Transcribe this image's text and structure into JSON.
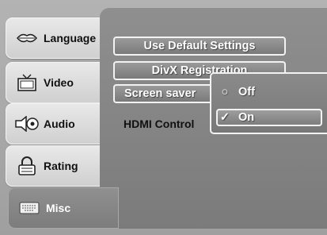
{
  "sidebar": {
    "items": [
      {
        "label": "Language",
        "icon": "lips-icon"
      },
      {
        "label": "Video",
        "icon": "tv-icon"
      },
      {
        "label": "Audio",
        "icon": "speaker-icon"
      },
      {
        "label": "Rating",
        "icon": "lock-icon"
      },
      {
        "label": "Misc",
        "icon": "keyboard-icon"
      }
    ],
    "active": "Misc"
  },
  "menu": {
    "use_default_settings": "Use Default Settings",
    "divx_registration": "DivX Registration",
    "screen_saver": "Screen saver",
    "hdmi_control": "HDMI Control"
  },
  "popup": {
    "options": [
      {
        "label": "Off",
        "mark": "○"
      },
      {
        "label": "On",
        "mark": "✓"
      }
    ],
    "selected": "On"
  }
}
